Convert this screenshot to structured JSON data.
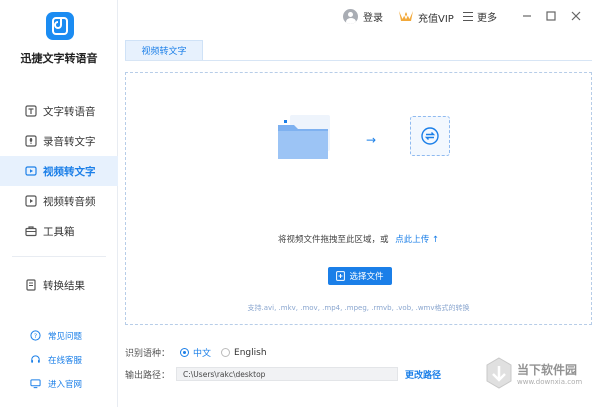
{
  "app": {
    "name": "迅捷文字转语音"
  },
  "sidebar": {
    "items": [
      {
        "label": "文字转语音",
        "icon": "text-speech-icon",
        "active": false
      },
      {
        "label": "录音转文字",
        "icon": "mic-icon",
        "active": false
      },
      {
        "label": "视频转文字",
        "icon": "video-icon",
        "active": true
      },
      {
        "label": "视频转音频",
        "icon": "video-audio-icon",
        "active": false
      },
      {
        "label": "工具箱",
        "icon": "toolbox-icon",
        "active": false
      }
    ],
    "result_label": "转换结果",
    "links": [
      {
        "label": "常见问题",
        "icon": "question-icon"
      },
      {
        "label": "在线客服",
        "icon": "headset-icon"
      },
      {
        "label": "进入官网",
        "icon": "monitor-icon"
      }
    ]
  },
  "header": {
    "login_label": "登录",
    "vip_label": "充值VIP",
    "more_label": "更多"
  },
  "tab": {
    "label": "视频转文字"
  },
  "drop_area": {
    "hint": "将视频文件拖拽至此区域，或",
    "upload_link": "点此上传",
    "choose_button": "选择文件",
    "support_text": "支持.avi, .mkv, .mov, .mp4, .mpeg, .rmvb, .vob, .wmv格式的转换"
  },
  "settings": {
    "language_label": "识别语种：",
    "language_options": [
      "中文",
      "English"
    ],
    "selected_language": "中文",
    "output_label": "输出路径：",
    "output_path": "C:\\Users\\rakc\\desktop",
    "change_path_label": "更改路径"
  },
  "watermark": {
    "name": "当下软件园",
    "url": "www.downxia.com"
  },
  "colors": {
    "accent": "#1b7fe8",
    "active_bg": "#e7f1fd"
  }
}
